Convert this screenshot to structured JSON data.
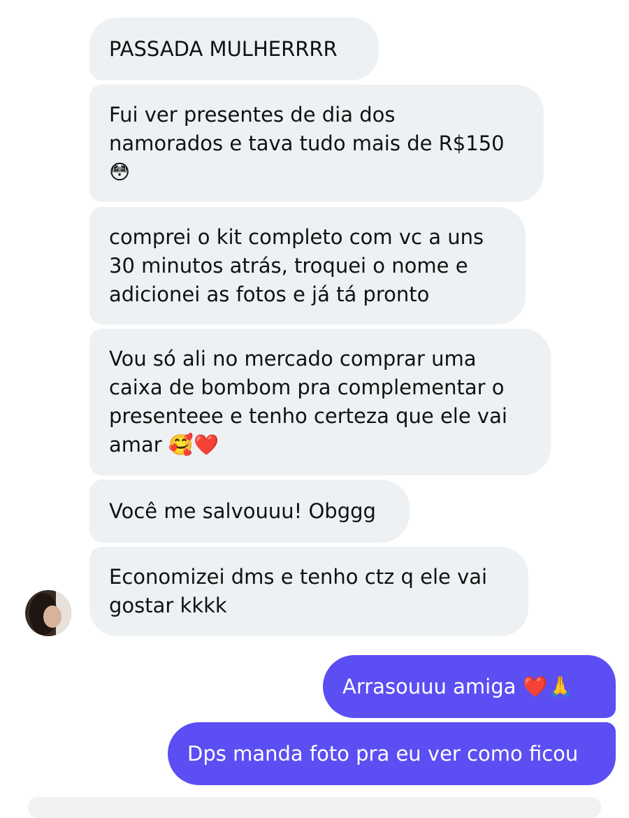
{
  "conversation": {
    "incoming": [
      {
        "text": "PASSADA MULHERRRR"
      },
      {
        "text": "Fui ver presentes de dia dos\nnamorados e tava tudo mais de R$150\n😳"
      },
      {
        "text": "comprei o kit completo com vc a uns\n30 minutos atrás, troquei o nome e\nadicionei as fotos e já tá pronto"
      },
      {
        "text": "Vou só ali no mercado comprar uma\ncaixa de bombom pra complementar o\npresenteee e tenho certeza que ele vai\namar 🥰❤️"
      },
      {
        "text": "Você me salvouuu! Obggg"
      },
      {
        "text": "Economizei dms e tenho ctz q ele vai\ngostar kkkk"
      }
    ],
    "outgoing": [
      {
        "text": "Arrasouuu amiga ❤️🙏"
      },
      {
        "text": "Dps manda foto pra eu ver como ficou"
      }
    ],
    "colors": {
      "incoming_bubble": "#eef1f3",
      "outgoing_bubble": "#5b4ef2",
      "outgoing_text": "#ffffff",
      "incoming_text": "#111111"
    },
    "sender_avatar": "contact-avatar"
  }
}
